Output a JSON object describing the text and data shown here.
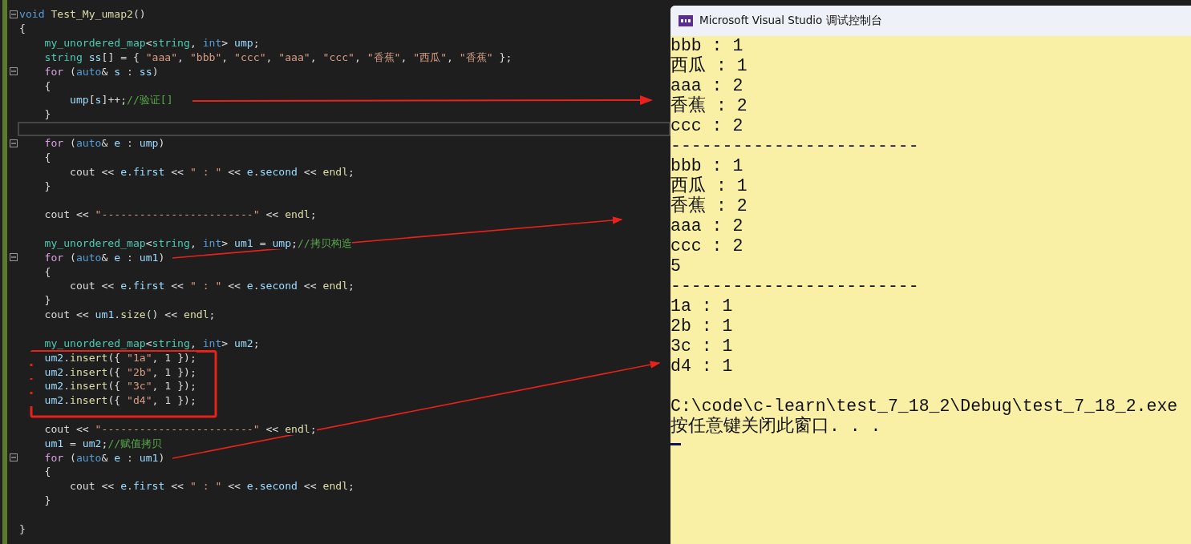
{
  "editor": {
    "lines": [
      {
        "kind": "fold",
        "tokens": [
          {
            "text": "void ",
            "kind": "kw"
          },
          {
            "text": "Test_My_umap2",
            "kind": "fn"
          },
          {
            "text": "()",
            "kind": "p"
          }
        ]
      },
      {
        "kind": "code",
        "tokens": [
          {
            "text": "{",
            "kind": "p"
          }
        ]
      },
      {
        "kind": "code",
        "tokens": [
          {
            "text": "    my_unordered_map",
            "kind": "type"
          },
          {
            "text": "<",
            "kind": "p"
          },
          {
            "text": "string",
            "kind": "type"
          },
          {
            "text": ", ",
            "kind": "p"
          },
          {
            "text": "int",
            "kind": "kw"
          },
          {
            "text": "> ",
            "kind": "p"
          },
          {
            "text": "ump",
            "kind": "var"
          },
          {
            "text": ";",
            "kind": "p"
          }
        ]
      },
      {
        "kind": "code",
        "tokens": [
          {
            "text": "    string ",
            "kind": "type"
          },
          {
            "text": "ss",
            "kind": "var"
          },
          {
            "text": "[] = { ",
            "kind": "p"
          },
          {
            "text": "\"aaa\"",
            "kind": "str"
          },
          {
            "text": ", ",
            "kind": "p"
          },
          {
            "text": "\"bbb\"",
            "kind": "str"
          },
          {
            "text": ", ",
            "kind": "p"
          },
          {
            "text": "\"ccc\"",
            "kind": "str"
          },
          {
            "text": ", ",
            "kind": "p"
          },
          {
            "text": "\"aaa\"",
            "kind": "str"
          },
          {
            "text": ", ",
            "kind": "p"
          },
          {
            "text": "\"ccc\"",
            "kind": "str"
          },
          {
            "text": ", ",
            "kind": "p"
          },
          {
            "text": "\"香蕉\"",
            "kind": "str"
          },
          {
            "text": ", ",
            "kind": "p"
          },
          {
            "text": "\"西瓜\"",
            "kind": "str"
          },
          {
            "text": ", ",
            "kind": "p"
          },
          {
            "text": "\"香蕉\"",
            "kind": "str"
          },
          {
            "text": " };",
            "kind": "p"
          }
        ]
      },
      {
        "kind": "fold",
        "tokens": [
          {
            "text": "    for ",
            "kind": "ctl"
          },
          {
            "text": "(",
            "kind": "p"
          },
          {
            "text": "auto",
            "kind": "kw"
          },
          {
            "text": "& ",
            "kind": "p"
          },
          {
            "text": "s",
            "kind": "var"
          },
          {
            "text": " : ",
            "kind": "p"
          },
          {
            "text": "ss",
            "kind": "var"
          },
          {
            "text": ")",
            "kind": "p"
          }
        ]
      },
      {
        "kind": "code",
        "tokens": [
          {
            "text": "    {",
            "kind": "p"
          }
        ]
      },
      {
        "kind": "code",
        "tokens": [
          {
            "text": "        ump",
            "kind": "var"
          },
          {
            "text": "[",
            "kind": "p"
          },
          {
            "text": "s",
            "kind": "var"
          },
          {
            "text": "]++;",
            "kind": "p"
          },
          {
            "text": "//验证[]",
            "kind": "com"
          }
        ]
      },
      {
        "kind": "code",
        "tokens": [
          {
            "text": "    }",
            "kind": "p"
          }
        ]
      },
      {
        "kind": "current"
      },
      {
        "kind": "fold",
        "tokens": [
          {
            "text": "    for ",
            "kind": "ctl"
          },
          {
            "text": "(",
            "kind": "p"
          },
          {
            "text": "auto",
            "kind": "kw"
          },
          {
            "text": "& ",
            "kind": "p"
          },
          {
            "text": "e",
            "kind": "var"
          },
          {
            "text": " : ",
            "kind": "p"
          },
          {
            "text": "ump",
            "kind": "var"
          },
          {
            "text": ")",
            "kind": "p"
          }
        ]
      },
      {
        "kind": "code",
        "tokens": [
          {
            "text": "    {",
            "kind": "p"
          }
        ]
      },
      {
        "kind": "code",
        "tokens": [
          {
            "text": "        cout << ",
            "kind": "p"
          },
          {
            "text": "e",
            "kind": "var"
          },
          {
            "text": ".",
            "kind": "p"
          },
          {
            "text": "first",
            "kind": "var"
          },
          {
            "text": " << ",
            "kind": "p"
          },
          {
            "text": "\" : \"",
            "kind": "str"
          },
          {
            "text": " << ",
            "kind": "p"
          },
          {
            "text": "e",
            "kind": "var"
          },
          {
            "text": ".",
            "kind": "p"
          },
          {
            "text": "second",
            "kind": "var"
          },
          {
            "text": " << ",
            "kind": "p"
          },
          {
            "text": "endl",
            "kind": "fn"
          },
          {
            "text": ";",
            "kind": "p"
          }
        ]
      },
      {
        "kind": "code",
        "tokens": [
          {
            "text": "    }",
            "kind": "p"
          }
        ]
      },
      {
        "kind": "blank"
      },
      {
        "kind": "code",
        "tokens": [
          {
            "text": "    cout << ",
            "kind": "p"
          },
          {
            "text": "\"------------------------\"",
            "kind": "str"
          },
          {
            "text": " << ",
            "kind": "p"
          },
          {
            "text": "endl",
            "kind": "fn"
          },
          {
            "text": ";",
            "kind": "p"
          }
        ]
      },
      {
        "kind": "blank"
      },
      {
        "kind": "code",
        "tokens": [
          {
            "text": "    my_unordered_map",
            "kind": "type"
          },
          {
            "text": "<",
            "kind": "p"
          },
          {
            "text": "string",
            "kind": "type"
          },
          {
            "text": ", ",
            "kind": "p"
          },
          {
            "text": "int",
            "kind": "kw"
          },
          {
            "text": "> ",
            "kind": "p"
          },
          {
            "text": "um1",
            "kind": "var"
          },
          {
            "text": " = ",
            "kind": "p"
          },
          {
            "text": "ump",
            "kind": "var"
          },
          {
            "text": ";",
            "kind": "p"
          },
          {
            "text": "//拷贝构造",
            "kind": "com"
          }
        ]
      },
      {
        "kind": "fold",
        "tokens": [
          {
            "text": "    for ",
            "kind": "ctl"
          },
          {
            "text": "(",
            "kind": "p"
          },
          {
            "text": "auto",
            "kind": "kw"
          },
          {
            "text": "& ",
            "kind": "p"
          },
          {
            "text": "e",
            "kind": "var"
          },
          {
            "text": " : ",
            "kind": "p"
          },
          {
            "text": "um1",
            "kind": "var"
          },
          {
            "text": ")",
            "kind": "p"
          }
        ]
      },
      {
        "kind": "code",
        "tokens": [
          {
            "text": "    {",
            "kind": "p"
          }
        ]
      },
      {
        "kind": "code",
        "tokens": [
          {
            "text": "        cout << ",
            "kind": "p"
          },
          {
            "text": "e",
            "kind": "var"
          },
          {
            "text": ".",
            "kind": "p"
          },
          {
            "text": "first",
            "kind": "var"
          },
          {
            "text": " << ",
            "kind": "p"
          },
          {
            "text": "\" : \"",
            "kind": "str"
          },
          {
            "text": " << ",
            "kind": "p"
          },
          {
            "text": "e",
            "kind": "var"
          },
          {
            "text": ".",
            "kind": "p"
          },
          {
            "text": "second",
            "kind": "var"
          },
          {
            "text": " << ",
            "kind": "p"
          },
          {
            "text": "endl",
            "kind": "fn"
          },
          {
            "text": ";",
            "kind": "p"
          }
        ]
      },
      {
        "kind": "code",
        "tokens": [
          {
            "text": "    }",
            "kind": "p"
          }
        ]
      },
      {
        "kind": "code",
        "tokens": [
          {
            "text": "    cout << ",
            "kind": "p"
          },
          {
            "text": "um1",
            "kind": "var"
          },
          {
            "text": ".",
            "kind": "p"
          },
          {
            "text": "size",
            "kind": "fn"
          },
          {
            "text": "() << ",
            "kind": "p"
          },
          {
            "text": "endl",
            "kind": "fn"
          },
          {
            "text": ";",
            "kind": "p"
          }
        ]
      },
      {
        "kind": "blank"
      },
      {
        "kind": "code",
        "tokens": [
          {
            "text": "    my_unordered_map",
            "kind": "type"
          },
          {
            "text": "<",
            "kind": "p"
          },
          {
            "text": "string",
            "kind": "type"
          },
          {
            "text": ", ",
            "kind": "p"
          },
          {
            "text": "int",
            "kind": "kw"
          },
          {
            "text": "> ",
            "kind": "p"
          },
          {
            "text": "um2",
            "kind": "var"
          },
          {
            "text": ";",
            "kind": "p"
          }
        ]
      },
      {
        "kind": "code",
        "tokens": [
          {
            "text": "    um2",
            "kind": "var"
          },
          {
            "text": ".",
            "kind": "p"
          },
          {
            "text": "insert",
            "kind": "fn"
          },
          {
            "text": "({ ",
            "kind": "p"
          },
          {
            "text": "\"1a\"",
            "kind": "str"
          },
          {
            "text": ", 1 });",
            "kind": "p"
          }
        ]
      },
      {
        "kind": "code",
        "tokens": [
          {
            "text": "    um2",
            "kind": "var"
          },
          {
            "text": ".",
            "kind": "p"
          },
          {
            "text": "insert",
            "kind": "fn"
          },
          {
            "text": "({ ",
            "kind": "p"
          },
          {
            "text": "\"2b\"",
            "kind": "str"
          },
          {
            "text": ", 1 });",
            "kind": "p"
          }
        ]
      },
      {
        "kind": "code",
        "tokens": [
          {
            "text": "    um2",
            "kind": "var"
          },
          {
            "text": ".",
            "kind": "p"
          },
          {
            "text": "insert",
            "kind": "fn"
          },
          {
            "text": "({ ",
            "kind": "p"
          },
          {
            "text": "\"3c\"",
            "kind": "str"
          },
          {
            "text": ", 1 });",
            "kind": "p"
          }
        ]
      },
      {
        "kind": "code",
        "tokens": [
          {
            "text": "    um2",
            "kind": "var"
          },
          {
            "text": ".",
            "kind": "p"
          },
          {
            "text": "insert",
            "kind": "fn"
          },
          {
            "text": "({ ",
            "kind": "p"
          },
          {
            "text": "\"d4\"",
            "kind": "str"
          },
          {
            "text": ", 1 });",
            "kind": "p"
          }
        ]
      },
      {
        "kind": "blank"
      },
      {
        "kind": "code",
        "tokens": [
          {
            "text": "    cout << ",
            "kind": "p"
          },
          {
            "text": "\"------------------------\"",
            "kind": "str"
          },
          {
            "text": " << ",
            "kind": "p"
          },
          {
            "text": "endl",
            "kind": "fn"
          },
          {
            "text": ";",
            "kind": "p"
          }
        ]
      },
      {
        "kind": "code",
        "tokens": [
          {
            "text": "    um1",
            "kind": "var"
          },
          {
            "text": " = ",
            "kind": "p"
          },
          {
            "text": "um2",
            "kind": "var"
          },
          {
            "text": ";",
            "kind": "p"
          },
          {
            "text": "//赋值拷贝",
            "kind": "com"
          }
        ]
      },
      {
        "kind": "fold",
        "tokens": [
          {
            "text": "    for ",
            "kind": "ctl"
          },
          {
            "text": "(",
            "kind": "p"
          },
          {
            "text": "auto",
            "kind": "kw"
          },
          {
            "text": "& ",
            "kind": "p"
          },
          {
            "text": "e",
            "kind": "var"
          },
          {
            "text": " : ",
            "kind": "p"
          },
          {
            "text": "um1",
            "kind": "var"
          },
          {
            "text": ")",
            "kind": "p"
          }
        ]
      },
      {
        "kind": "code",
        "tokens": [
          {
            "text": "    {",
            "kind": "p"
          }
        ]
      },
      {
        "kind": "code",
        "tokens": [
          {
            "text": "        cout << ",
            "kind": "p"
          },
          {
            "text": "e",
            "kind": "var"
          },
          {
            "text": ".",
            "kind": "p"
          },
          {
            "text": "first",
            "kind": "var"
          },
          {
            "text": " << ",
            "kind": "p"
          },
          {
            "text": "\" : \"",
            "kind": "str"
          },
          {
            "text": " << ",
            "kind": "p"
          },
          {
            "text": "e",
            "kind": "var"
          },
          {
            "text": ".",
            "kind": "p"
          },
          {
            "text": "second",
            "kind": "var"
          },
          {
            "text": " << ",
            "kind": "p"
          },
          {
            "text": "endl",
            "kind": "fn"
          },
          {
            "text": ";",
            "kind": "p"
          }
        ]
      },
      {
        "kind": "code",
        "tokens": [
          {
            "text": "    }",
            "kind": "p"
          }
        ]
      },
      {
        "kind": "blank"
      },
      {
        "kind": "code",
        "tokens": [
          {
            "text": "}",
            "kind": "p"
          }
        ]
      }
    ]
  },
  "console": {
    "title": "Microsoft Visual Studio 调试控制台",
    "lines": [
      "bbb : 1",
      "西瓜 : 1",
      "aaa : 2",
      "香蕉 : 2",
      "ccc : 2",
      "------------------------",
      "bbb : 1",
      "西瓜 : 1",
      "香蕉 : 2",
      "aaa : 2",
      "ccc : 2",
      "5",
      "------------------------",
      "1a : 1",
      "2b : 1",
      "3c : 1",
      "d4 : 1"
    ],
    "exit_message": [
      "C:\\code\\c-learn\\test_7_18_2\\Debug\\test_7_18_2.exe",
      "按任意键关闭此窗口. . ."
    ]
  }
}
